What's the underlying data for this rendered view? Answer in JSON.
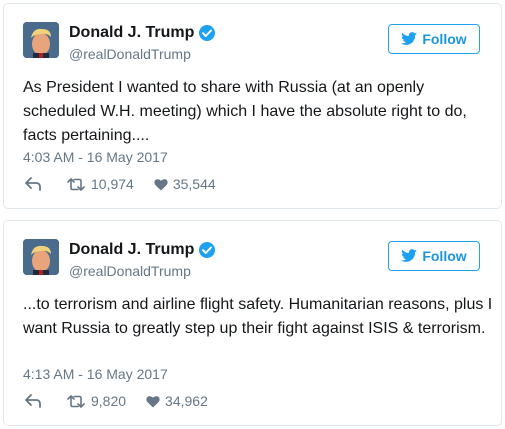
{
  "tweets": [
    {
      "name": "Donald J. Trump",
      "handle": "@realDonaldTrump",
      "follow_label": "Follow",
      "text": "As President I wanted to share with Russia (at an openly scheduled W.H. meeting) which I have the absolute right to do, facts pertaining....",
      "timestamp": "4:03 AM - 16 May 2017",
      "retweets": "10,974",
      "likes": "35,544"
    },
    {
      "name": "Donald J. Trump",
      "handle": "@realDonaldTrump",
      "follow_label": "Follow",
      "text": "...to terrorism and airline flight safety. Humanitarian reasons, plus I want Russia to greatly step up their fight against ISIS & terrorism.",
      "timestamp": "4:13 AM - 16 May 2017",
      "retweets": "9,820",
      "likes": "34,962"
    }
  ],
  "colors": {
    "accent": "#1da1f2",
    "secondary_text": "#657786",
    "border": "#e1e8ed"
  },
  "icons": [
    "verified-icon",
    "bird-icon",
    "reply-icon",
    "retweet-icon",
    "like-icon"
  ]
}
